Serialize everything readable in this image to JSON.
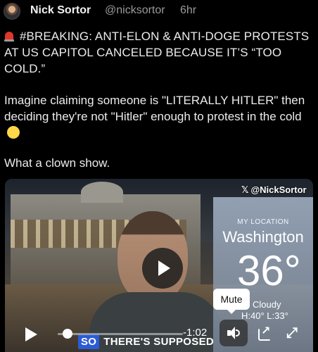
{
  "post": {
    "author": "Nick Sortor",
    "handle": "@nicksortor",
    "time": "6hr",
    "headline": "#BREAKING: ANTI-ELON & ANTI-DOGE PROTESTS AT US CAPITOL CANCELED BECAUSE IT’S “TOO COLD.”",
    "body": "Imagine claiming someone is \"LITERALLY HITLER\" then deciding they're not \"Hitler\" enough to protest in the cold",
    "closing": "What a clown show."
  },
  "video": {
    "watermark": "@NickSortor",
    "weather": {
      "location_label": "MY LOCATION",
      "city": "Washington",
      "temperature": "36°",
      "condition": "Cloudy",
      "hi_lo": "H:40°  L:33°"
    },
    "caption_highlight": "SO",
    "caption_rest": "THERE'S SUPPOSED",
    "time_remaining": "-1:02",
    "tooltip": "Mute",
    "progress": 0.08
  },
  "icons": {
    "siren": "siren-icon",
    "emoji": "rolling-laughing-emoji",
    "play": "play-icon",
    "volume": "volume-icon",
    "popout": "popout-icon",
    "fullscreen": "fullscreen-icon"
  }
}
